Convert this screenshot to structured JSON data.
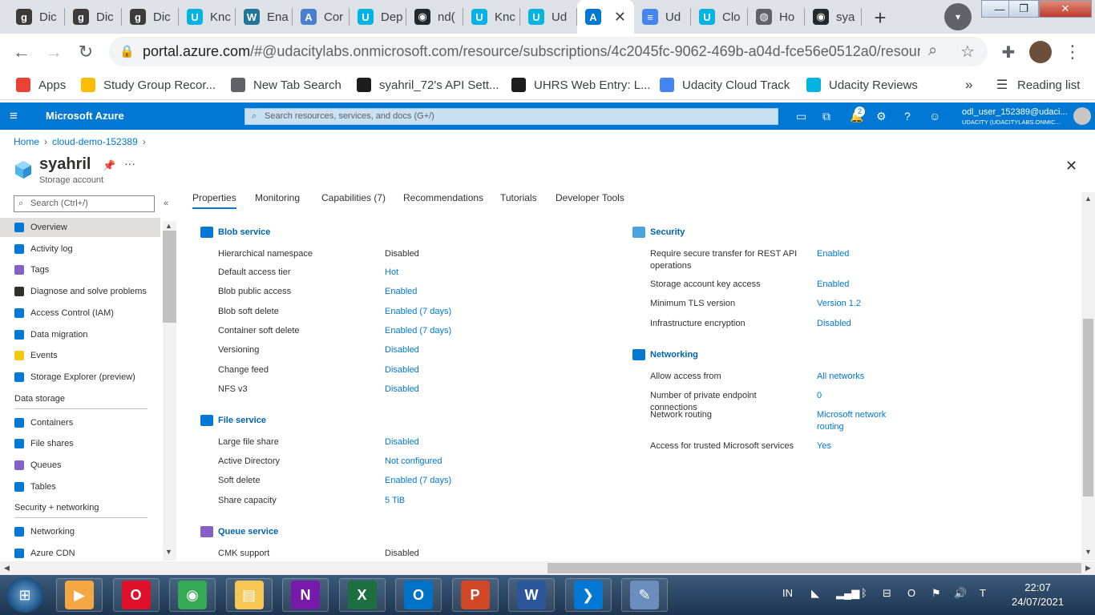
{
  "browser": {
    "tabs": [
      {
        "label": "Dic",
        "icon": "g-icon",
        "color": "#3c3c3c",
        "glyph": "g"
      },
      {
        "label": "Dic",
        "icon": "g-icon",
        "color": "#3c3c3c",
        "glyph": "g"
      },
      {
        "label": "Dic",
        "icon": "g-icon",
        "color": "#3c3c3c",
        "glyph": "g"
      },
      {
        "label": "Knc",
        "icon": "udacity-icon",
        "color": "#02b3e4",
        "glyph": "U"
      },
      {
        "label": "Ena",
        "icon": "wordpress-icon",
        "color": "#21759b",
        "glyph": "W"
      },
      {
        "label": "Cor",
        "icon": "a-circle-icon",
        "color": "#4a7fd0",
        "glyph": "A"
      },
      {
        "label": "Dep",
        "icon": "udacity-icon",
        "color": "#02b3e4",
        "glyph": "U"
      },
      {
        "label": "nd(",
        "icon": "github-icon",
        "color": "#24292e",
        "glyph": "◉"
      },
      {
        "label": "Knc",
        "icon": "udacity-icon",
        "color": "#02b3e4",
        "glyph": "U"
      },
      {
        "label": "Ud",
        "icon": "udacity-icon",
        "color": "#02b3e4",
        "glyph": "U"
      },
      {
        "label": "",
        "icon": "azure-icon",
        "color": "#0078d4",
        "glyph": "A"
      },
      {
        "label": "Ud",
        "icon": "docs-icon",
        "color": "#4285f4",
        "glyph": "≡"
      },
      {
        "label": "Clo",
        "icon": "udacity-icon",
        "color": "#02b3e4",
        "glyph": "U"
      },
      {
        "label": "Ho",
        "icon": "globe-icon",
        "color": "#5f6368",
        "glyph": "◍"
      },
      {
        "label": "sya",
        "icon": "github-icon",
        "color": "#24292e",
        "glyph": "◉"
      }
    ],
    "url_host": "portal.azure.com",
    "url_rest": "/#@udacitylabs.onmicrosoft.com/resource/subscriptions/4c2045fc-9062-469b-a04d-fce56e0512a0/resour...",
    "bookmarks": [
      {
        "label": "Apps",
        "color": "#ea4335"
      },
      {
        "label": "Study Group Recor...",
        "color": "#fbbc04"
      },
      {
        "label": "New Tab Search",
        "color": "#5f6368"
      },
      {
        "label": "syahril_72's API Sett...",
        "color": "#1d1d1d"
      },
      {
        "label": "UHRS Web Entry: L...",
        "color": "#1d1d1d"
      },
      {
        "label": "Udacity Cloud Track",
        "color": "#4285f4"
      },
      {
        "label": "Udacity Reviews",
        "color": "#02b3e4"
      }
    ],
    "bookmarks_more": "»",
    "reading_list": "Reading list"
  },
  "azure": {
    "brand": "Microsoft Azure",
    "search_placeholder": "Search resources, services, and docs (G+/)",
    "notification_count": "2",
    "user_name": "odl_user_152389@udaci...",
    "user_tenant": "UDACITY (UDACITYLABS.ONMIC..."
  },
  "breadcrumb": [
    "Home",
    "cloud-demo-152389"
  ],
  "resource": {
    "title": "syahril",
    "subtitle": "Storage account"
  },
  "sidebar": {
    "search_placeholder": "Search (Ctrl+/)",
    "items": [
      {
        "label": "Overview",
        "icon": "overview-icon",
        "color": "#0078d4"
      },
      {
        "label": "Activity log",
        "icon": "activity-log-icon",
        "color": "#0078d4"
      },
      {
        "label": "Tags",
        "icon": "tag-icon",
        "color": "#8661c5"
      },
      {
        "label": "Diagnose and solve problems",
        "icon": "wrench-icon",
        "color": "#323130"
      },
      {
        "label": "Access Control (IAM)",
        "icon": "people-icon",
        "color": "#0078d4"
      },
      {
        "label": "Data migration",
        "icon": "migration-icon",
        "color": "#0078d4"
      },
      {
        "label": "Events",
        "icon": "lightning-icon",
        "color": "#f2c811"
      },
      {
        "label": "Storage Explorer (preview)",
        "icon": "storage-explorer-icon",
        "color": "#0078d4"
      }
    ],
    "group_data": "Data storage",
    "data_items": [
      {
        "label": "Containers",
        "icon": "containers-icon",
        "color": "#0078d4"
      },
      {
        "label": "File shares",
        "icon": "file-shares-icon",
        "color": "#0078d4"
      },
      {
        "label": "Queues",
        "icon": "queues-icon",
        "color": "#8661c5"
      },
      {
        "label": "Tables",
        "icon": "tables-icon",
        "color": "#0078d4"
      }
    ],
    "group_security": "Security + networking",
    "security_items": [
      {
        "label": "Networking",
        "icon": "networking-icon",
        "color": "#0078d4"
      },
      {
        "label": "Azure CDN",
        "icon": "cdn-icon",
        "color": "#0078d4"
      }
    ]
  },
  "tabs": [
    "Properties",
    "Monitoring",
    "Capabilities (7)",
    "Recommendations",
    "Tutorials",
    "Developer Tools"
  ],
  "blob": {
    "title": "Blob service",
    "rows": [
      {
        "label": "Hierarchical namespace",
        "value": "Disabled",
        "link": false
      },
      {
        "label": "Default access tier",
        "value": "Hot",
        "link": true
      },
      {
        "label": "Blob public access",
        "value": "Enabled",
        "link": true
      },
      {
        "label": "Blob soft delete",
        "value": "Enabled (7 days)",
        "link": true
      },
      {
        "label": "Container soft delete",
        "value": "Enabled (7 days)",
        "link": true
      },
      {
        "label": "Versioning",
        "value": "Disabled",
        "link": true
      },
      {
        "label": "Change feed",
        "value": "Disabled",
        "link": true
      },
      {
        "label": "NFS v3",
        "value": "Disabled",
        "link": true
      }
    ]
  },
  "file": {
    "title": "File service",
    "rows": [
      {
        "label": "Large file share",
        "value": "Disabled",
        "link": true
      },
      {
        "label": "Active Directory",
        "value": "Not configured",
        "link": true
      },
      {
        "label": "Soft delete",
        "value": "Enabled (7 days)",
        "link": true
      },
      {
        "label": "Share capacity",
        "value": "5 TiB",
        "link": true
      }
    ]
  },
  "queue": {
    "title": "Queue service",
    "rows": [
      {
        "label": "CMK support",
        "value": "Disabled",
        "link": false
      }
    ]
  },
  "security": {
    "title": "Security",
    "rows": [
      {
        "label": "Require secure transfer for REST API operations",
        "value": "Enabled",
        "link": true
      },
      {
        "label": "Storage account key access",
        "value": "Enabled",
        "link": true
      },
      {
        "label": "Minimum TLS version",
        "value": "Version 1.2",
        "link": true
      },
      {
        "label": "Infrastructure encryption",
        "value": "Disabled",
        "link": true
      }
    ]
  },
  "networking": {
    "title": "Networking",
    "rows": [
      {
        "label": "Allow access from",
        "value": "All networks",
        "link": true
      },
      {
        "label": "Number of private endpoint connections",
        "value": "0",
        "link": true
      },
      {
        "label": "Network routing",
        "value": "Microsoft network routing",
        "link": true
      },
      {
        "label": "Access for trusted Microsoft services",
        "value": "Yes",
        "link": true
      }
    ]
  },
  "taskbar": {
    "apps": [
      {
        "name": "media-player-icon",
        "glyph": "▶",
        "color": "#f4a742"
      },
      {
        "name": "opera-icon",
        "glyph": "O",
        "color": "#e0102b"
      },
      {
        "name": "chrome-icon",
        "glyph": "◉",
        "color": "#34a853"
      },
      {
        "name": "file-explorer-icon",
        "glyph": "▤",
        "color": "#f6c655"
      },
      {
        "name": "onenote-icon",
        "glyph": "N",
        "color": "#7719aa"
      },
      {
        "name": "excel-icon",
        "glyph": "X",
        "color": "#1d6f42"
      },
      {
        "name": "outlook-icon",
        "glyph": "O",
        "color": "#0072c6"
      },
      {
        "name": "powerpoint-icon",
        "glyph": "P",
        "color": "#d24726"
      },
      {
        "name": "word-icon",
        "glyph": "W",
        "color": "#2b579a"
      },
      {
        "name": "vscode-icon",
        "glyph": "❯",
        "color": "#0078d4"
      },
      {
        "name": "paint-icon",
        "glyph": "✎",
        "color": "#6c8ebf"
      }
    ],
    "language": "IN",
    "time": "22:07",
    "date": "24/07/2021"
  }
}
